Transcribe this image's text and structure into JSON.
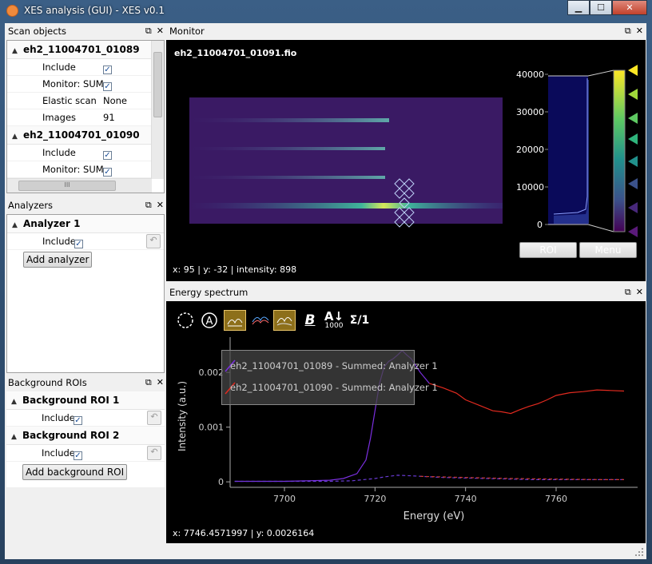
{
  "window": {
    "title": "XES analysis (GUI) - XES v0.1",
    "minimize": "▁",
    "maximize": "☐",
    "close": "✕"
  },
  "scan_objects": {
    "title": "Scan objects",
    "scans": [
      {
        "name": "eh2_11004701_01089",
        "include_label": "Include",
        "monitor_label": "Monitor: SUM",
        "elastic_label": "Elastic scan",
        "elastic_value": "None",
        "images_label": "Images",
        "images_value": "91"
      },
      {
        "name": "eh2_11004701_01090",
        "include_label": "Include",
        "monitor_label": "Monitor: SUM"
      }
    ],
    "hscroll_grip": "III"
  },
  "analyzers": {
    "title": "Analyzers",
    "items": [
      {
        "name": "Analyzer 1",
        "include_label": "Include"
      }
    ],
    "add_label": "Add analyzer"
  },
  "background_rois": {
    "title": "Background ROIs",
    "items": [
      {
        "name": "Background ROI 1",
        "include_label": "Include"
      },
      {
        "name": "Background ROI 2",
        "include_label": "Include"
      }
    ],
    "add_label": "Add background ROI"
  },
  "monitor": {
    "title": "Monitor",
    "image_title": "eh2_11004701_01091.fio",
    "cursor_readout": "x: 95 | y: -32 | intensity: 898",
    "hist_ticks": [
      "40000",
      "30000",
      "20000",
      "10000",
      "0"
    ],
    "roi_label": "ROI",
    "menu_label": "Menu"
  },
  "energy": {
    "title": "Energy spectrum",
    "tools": {
      "bold": "B",
      "sort_top": "A",
      "sort_arrow": "↓",
      "sort_bottom": "1000",
      "sum": "Σ/1"
    },
    "cursor_readout": "x: 7746.4571997 | y: 0.0026164"
  },
  "chart_data": {
    "type": "line",
    "xlabel": "Energy (eV)",
    "ylabel": "Intensity (a.u.)",
    "x_ticks": [
      "7700",
      "7720",
      "7740",
      "7760"
    ],
    "y_ticks": [
      "0",
      "0.001",
      "0.002"
    ],
    "xlim": [
      7688,
      7778
    ],
    "ylim": [
      -0.0001,
      0.0025
    ],
    "legend_placement": "top-left",
    "series": [
      {
        "name": "eh2_11004701_01089 - Summed: Analyzer 1",
        "color": "#7b2fe0",
        "style": "solid",
        "x": [
          7689,
          7695,
          7700,
          7705,
          7710,
          7713,
          7716,
          7718,
          7719,
          7720,
          7721,
          7722,
          7723,
          7724,
          7725,
          7726,
          7727,
          7728,
          7730,
          7732
        ],
        "y": [
          1e-05,
          1e-05,
          1e-05,
          2e-05,
          3e-05,
          6e-05,
          0.00015,
          0.0004,
          0.0008,
          0.0013,
          0.0018,
          0.0021,
          0.0022,
          0.00225,
          0.00232,
          0.0024,
          0.00232,
          0.00225,
          0.002,
          0.0018
        ]
      },
      {
        "name": "eh2_11004701_01090 - Summed: Analyzer 1",
        "color": "#e12a1f",
        "style": "solid",
        "x": [
          7732,
          7735,
          7738,
          7740,
          7743,
          7746,
          7748,
          7750,
          7752,
          7754,
          7756,
          7758,
          7760,
          7763,
          7766,
          7769,
          7772,
          7775
        ],
        "y": [
          0.0018,
          0.00172,
          0.00162,
          0.0015,
          0.0014,
          0.0013,
          0.00128,
          0.00125,
          0.00132,
          0.00138,
          0.00143,
          0.0015,
          0.00158,
          0.00163,
          0.00165,
          0.00168,
          0.00167,
          0.00166
        ]
      },
      {
        "name": "",
        "color": "#6a3bd6",
        "style": "dashed",
        "x": [
          7689,
          7700,
          7710,
          7715,
          7720,
          7722,
          7725,
          7728,
          7735,
          7745,
          7755,
          7765,
          7775
        ],
        "y": [
          1e-05,
          1e-05,
          1e-05,
          2e-05,
          6e-05,
          9e-05,
          0.00012,
          0.00011,
          8e-05,
          6e-05,
          4e-05,
          4e-05,
          4e-05
        ]
      },
      {
        "name": "",
        "color": "#c73a34",
        "style": "dashed",
        "x": [
          7730,
          7740,
          7750,
          7760,
          7770,
          7775
        ],
        "y": [
          0.0001,
          8e-05,
          6e-05,
          5e-05,
          4e-05,
          4e-05
        ]
      }
    ]
  }
}
